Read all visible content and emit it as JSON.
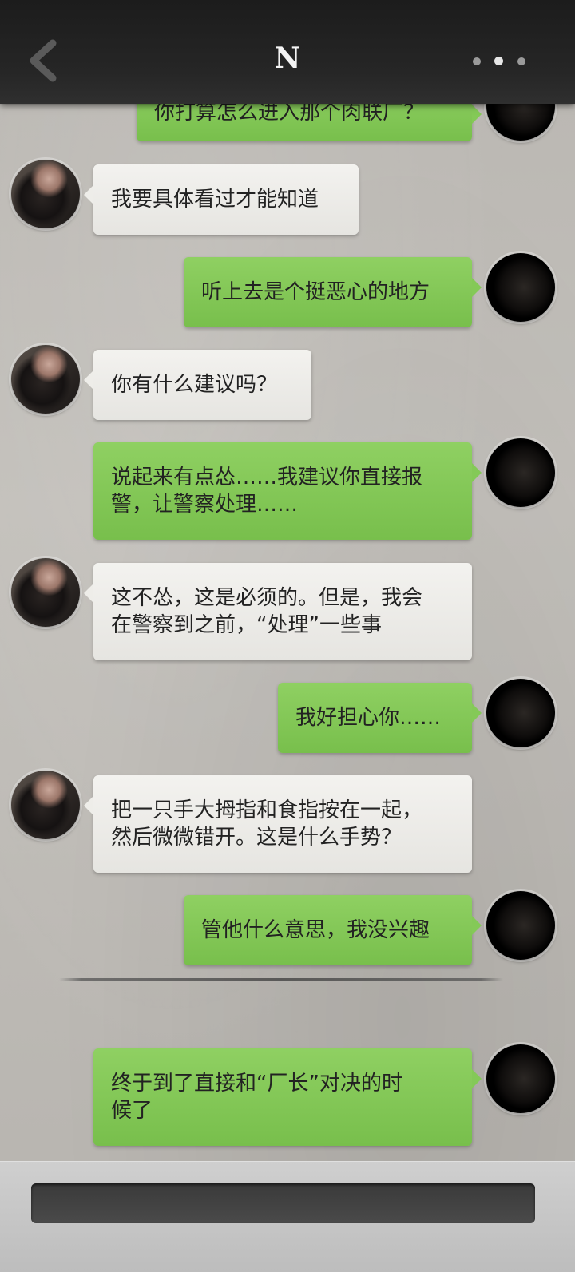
{
  "header": {
    "title": "N"
  },
  "messages": [
    {
      "text": "你打算怎么进入那个肉联厂？"
    },
    {
      "text": "我要具体看过才能知道"
    },
    {
      "text": "听上去是个挺恶心的地方"
    },
    {
      "text": "你有什么建议吗？"
    },
    {
      "text": "说起来有点怂……我建议你直接报\n警，让警察处理……"
    },
    {
      "text": "这不怂，这是必须的。但是，我会\n在警察到之前，“处理”一些事"
    },
    {
      "text": "我好担心你……"
    },
    {
      "text": "把一只手大拇指和食指按在一起，\n然后微微错开。这是什么手势？"
    },
    {
      "text": "管他什么意思，我没兴趣"
    },
    {
      "text": "终于到了直接和“厂长”对决的时\n候了"
    }
  ],
  "icons": {
    "back": "chevron-left-icon",
    "more": "more-dots-icon"
  },
  "colors": {
    "bubble_right": "#82c656",
    "bubble_left": "#efeeea",
    "topbar": "#222222"
  },
  "input": {
    "placeholder": ""
  }
}
